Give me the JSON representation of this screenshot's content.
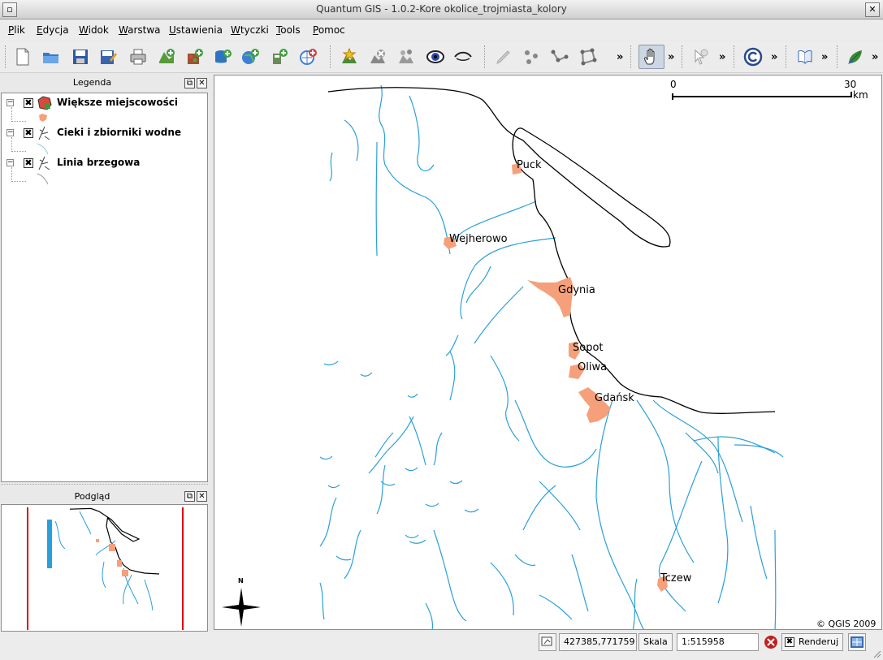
{
  "window": {
    "title": "Quantum GIS - 1.0.2-Kore  okolice_trojmiasta_kolory"
  },
  "menu": [
    {
      "label": "Plik"
    },
    {
      "label": "Edycja"
    },
    {
      "label": "Widok"
    },
    {
      "label": "Warstwa"
    },
    {
      "label": "Ustawienia"
    },
    {
      "label": "Wtyczki"
    },
    {
      "label": "Tools"
    },
    {
      "label": "Pomoc"
    }
  ],
  "toolbar": {
    "icons": [
      "new-project-icon",
      "open-project-icon",
      "save-project-icon",
      "save-as-icon",
      "print-icon",
      "add-vector-layer-icon",
      "add-raster-layer-icon",
      "add-postgis-layer-icon",
      "add-wms-layer-icon",
      "new-vector-layer-icon",
      "add-wfs-layer-icon",
      "add-to-overview-icon",
      "remove-layer-icon",
      "toggle-layers-icon",
      "show-all-icon",
      "hide-all-icon",
      "edit-pencil-icon",
      "capture-point-icon",
      "capture-line-icon",
      "capture-polygon-icon",
      "pan-hand-icon",
      "identify-icon",
      "copyright-icon",
      "open-book-icon",
      "plugin-leaf-icon"
    ],
    "overflow": "»"
  },
  "legend": {
    "title": "Legenda",
    "layers": [
      {
        "label": "Większe miejscowości",
        "checked": "✖",
        "symbol_color": "#f5a07a"
      },
      {
        "label": "Cieki i zbiorniki wodne",
        "checked": "✖",
        "symbol_color": "#2aa0d8"
      },
      {
        "label": "Linia brzegowa",
        "checked": "✖",
        "symbol_color": "#000000"
      }
    ]
  },
  "overview": {
    "title": "Podgląd"
  },
  "map": {
    "cities": [
      "Puck",
      "Wejherowo",
      "Gdynia",
      "Sopot",
      "Oliwa",
      "Gdańsk",
      "Tczew"
    ],
    "scalebar": {
      "start": "0",
      "end": "30",
      "unit": "km"
    },
    "north": "N",
    "copyright": "© QGIS 2009",
    "colors": {
      "city": "#f5a07a",
      "water": "#2aa0d8",
      "coast": "#000000"
    }
  },
  "statusbar": {
    "coordinates": "427385,771759",
    "scale_label": "Skala",
    "scale_value": "1:515958",
    "render_label": "Renderuj"
  }
}
